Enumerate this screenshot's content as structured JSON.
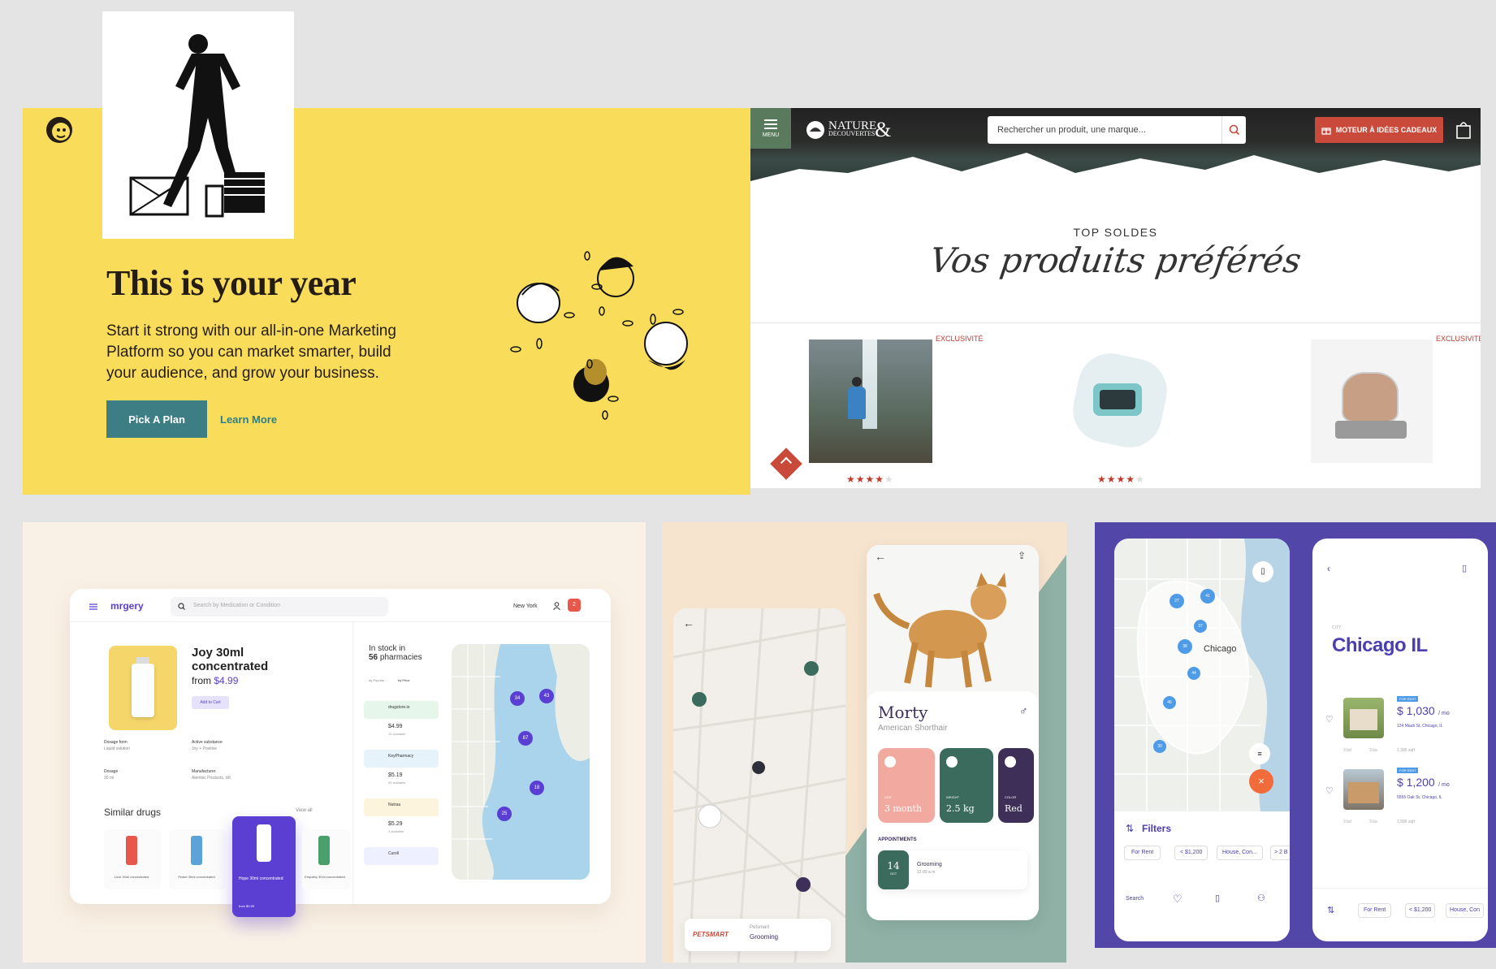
{
  "mailchimp": {
    "headline": "This is your year",
    "body": "Start it strong with our all-in-one Marketing Platform so you can market smarter, build your audience, and grow your business.",
    "primary_button": "Pick A Plan",
    "secondary_link": "Learn More",
    "colors": {
      "background": "#f9dd5a",
      "button": "#3d7e85"
    }
  },
  "nature": {
    "menu_label": "MENU",
    "logo_top": "NATURE",
    "logo_bottom": "DECOUVERTES",
    "search_placeholder": "Rechercher un produit, une marque...",
    "gift_button": "MOTEUR À IDÉES CADEAUX",
    "section_kicker": "TOP SOLDES",
    "section_title": "Vos produits préférés",
    "badge": "EXCLUSIVITÉ",
    "products": [
      {
        "name": "waterfall-poster",
        "rating": 4
      },
      {
        "name": "alarm-clock",
        "rating": 4
      },
      {
        "name": "teapot",
        "rating": null
      }
    ],
    "colors": {
      "accent": "#c94a3a",
      "menu": "#5a7a5e"
    }
  },
  "mrgery": {
    "logo": "mrgery",
    "search_placeholder": "Search by Medication or Condition",
    "location": "New York",
    "cart_count": "2",
    "product_name_1": "Joy 30ml",
    "product_name_2": "concentrated",
    "price_prefix": "from",
    "price": "$4.99",
    "add_to_cart": "Add to Cart",
    "details": [
      {
        "label": "Dosage form",
        "value": "Liquid solution"
      },
      {
        "label": "Active substance",
        "value": "Joy + Positive"
      },
      {
        "label": "Dosage",
        "value": "30 ml"
      },
      {
        "label": "Manufacturer",
        "value": "Alembic Products, UK"
      }
    ],
    "similar_title": "Similar drugs",
    "view_all": "View all",
    "similar": [
      {
        "name": "Love 30ml concentrated"
      },
      {
        "name": "Peace 30ml concentrated"
      },
      {
        "name": "Hope 30ml concentrated",
        "price": "from $0.99"
      },
      {
        "name": "Empathy 30ml concentrated"
      }
    ],
    "stock_title_1": "In stock in",
    "stock_count": "56",
    "stock_title_2": "pharmacies",
    "sort_popular": "by Popular",
    "sort_price": "by Price",
    "pharmacies": [
      {
        "name": "drugstore.io",
        "price": "$4.99",
        "stock": "15 available"
      },
      {
        "name": "KeyPharmacy",
        "price": "$5.19",
        "stock": "99 available"
      },
      {
        "name": "Nutraa",
        "price": "$5.29",
        "stock": "3 available"
      },
      {
        "name": "Curoll",
        "price": "",
        "stock": ""
      }
    ],
    "map_pins": [
      "34",
      "43",
      "87",
      "18",
      "25"
    ],
    "colors": {
      "accent": "#5b3fd3",
      "bottle": "#f5d66b"
    }
  },
  "pet": {
    "pet_name": "Morty",
    "breed": "American Shorthair",
    "stats": [
      {
        "label": "AGE",
        "value": "3 month"
      },
      {
        "label": "WEIGHT",
        "value": "2.5 kg"
      },
      {
        "label": "COLOR",
        "value": "Red"
      }
    ],
    "appointments_title": "APPOINTMENTS",
    "appointment": {
      "day": "14",
      "month": "OCT",
      "title": "Grooming",
      "time": "12:00 a.m"
    },
    "brand": "PETSMART",
    "map_card": {
      "place": "Petsmart",
      "service": "Grooming"
    },
    "colors": {
      "green": "#3a6b5c",
      "pink": "#f2a9a0",
      "purple": "#3d2f58"
    }
  },
  "realty": {
    "map_city": "Chicago",
    "pins": [
      "27",
      "41",
      "37",
      "38",
      "44",
      "46",
      "30"
    ],
    "filters_title": "Filters",
    "chips": [
      "For Rent",
      "< $1,200",
      "House, Con...",
      "> 2 B"
    ],
    "nav": [
      "Search"
    ],
    "city_label": "CITY",
    "city": "Chicago IL",
    "listings": [
      {
        "badge": "FOR RENT",
        "price": "$ 1,030",
        "unit": "/ mo",
        "address": "124 Maub St, Chicago, IL",
        "specs": [
          "3 bd",
          "3 ba",
          "2,386 sqft"
        ]
      },
      {
        "badge": "FOR RENT",
        "price": "$ 1,200",
        "unit": "/ mo",
        "address": "5555 Oak St, Chicago, IL",
        "specs": [
          "3 bd",
          "3 ba",
          "2,586 sqft"
        ]
      }
    ],
    "bottom_chips": [
      "For Rent",
      "< $1,200",
      "House, Con"
    ],
    "colors": {
      "accent": "#4a3fb0",
      "orange": "#f26b3a"
    }
  }
}
